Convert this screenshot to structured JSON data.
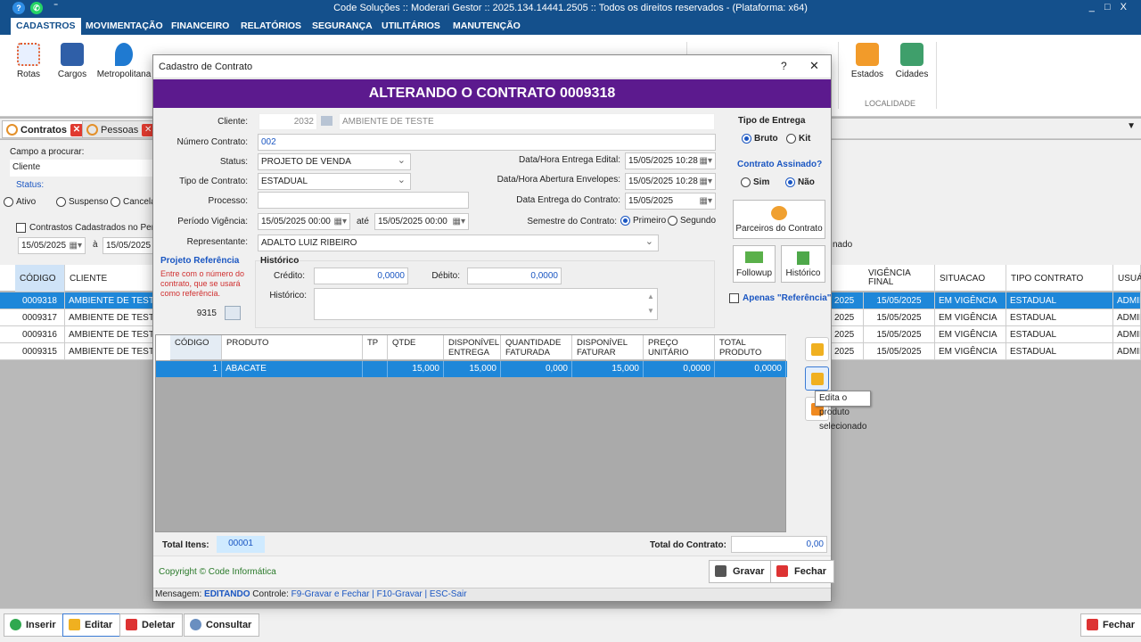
{
  "window": {
    "title": "Code Soluções :: Moderari Gestor :: 2025.134.14441.2505 :: Todos os direitos reservados - (Plataforma: x64)",
    "controls": "_ □ X"
  },
  "menu": [
    "CADASTROS",
    "MOVIMENTAÇÃO",
    "FINANCEIRO",
    "RELATÓRIOS",
    "SEGURANÇA",
    "UTILITÁRIOS",
    "MANUTENÇÃO"
  ],
  "ribbon": {
    "items": [
      "Rotas",
      "Cargos",
      "Metropolitana"
    ],
    "right_items": [
      "Estados",
      "Cidades"
    ],
    "group_label": "LOCALIDADE",
    "extra": "nado"
  },
  "tabs": [
    "Contratos",
    "Pessoas"
  ],
  "filter": {
    "campo_label": "Campo a procurar:",
    "campo_value": "Cliente",
    "status_label": "Status:",
    "status_opts": [
      "Ativo",
      "Suspenso",
      "Cancela"
    ],
    "periodo_label": "Contrastos Cadastrados no Período",
    "date_from": "15/05/2025",
    "a": "à",
    "date_to": "15/05/2025"
  },
  "grid": {
    "headers": [
      "CÓDIGO",
      "CLIENTE",
      "VIGÊNCIA FINAL",
      "SITUACAO",
      "TIPO CONTRATO",
      "USUÁ"
    ],
    "rows": [
      {
        "codigo": "0009318",
        "cliente": "AMBIENTE DE TESTE",
        "frag": "2025",
        "vig": "15/05/2025",
        "sit": "EM VIGÊNCIA",
        "tipo": "ESTADUAL",
        "usr": "ADMIN"
      },
      {
        "codigo": "0009317",
        "cliente": "AMBIENTE DE TESTE",
        "frag": "2025",
        "vig": "15/05/2025",
        "sit": "EM VIGÊNCIA",
        "tipo": "ESTADUAL",
        "usr": "ADMIN"
      },
      {
        "codigo": "0009316",
        "cliente": "AMBIENTE DE TESTE",
        "frag": "2025",
        "vig": "15/05/2025",
        "sit": "EM VIGÊNCIA",
        "tipo": "ESTADUAL",
        "usr": "ADMIN"
      },
      {
        "codigo": "0009315",
        "cliente": "AMBIENTE DE TESTE",
        "frag": "2025",
        "vig": "15/05/2025",
        "sit": "EM VIGÊNCIA",
        "tipo": "ESTADUAL",
        "usr": "ADMIN"
      }
    ]
  },
  "bottom": {
    "inserir": "Inserir",
    "editar": "Editar",
    "deletar": "Deletar",
    "consultar": "Consultar",
    "fechar": "Fechar"
  },
  "dialog": {
    "title": "Cadastro de Contrato",
    "help": "?",
    "close": "✕",
    "banner": "ALTERANDO O CONTRATO 0009318",
    "cliente_label": "Cliente:",
    "cliente_code": "2032",
    "cliente_name": "AMBIENTE DE TESTE",
    "numero_label": "Número Contrato:",
    "numero_value": "002",
    "status_label": "Status:",
    "status_value": "PROJETO DE VENDA",
    "tipo_label": "Tipo de Contrato:",
    "tipo_value": "ESTADUAL",
    "processo_label": "Processo:",
    "processo_value": "",
    "vigencia_label": "Período Vigência:",
    "vig_from": "15/05/2025 00:00",
    "ate": "até",
    "vig_to": "15/05/2025 00:00",
    "rep_label": "Representante:",
    "rep_value": "ADALTO LUIZ RIBEIRO",
    "entrega_edital_label": "Data/Hora Entrega Edital:",
    "entrega_edital": "15/05/2025 10:28",
    "abertura_label": "Data/Hora Abertura Envelopes:",
    "abertura": "15/05/2025 10:28",
    "entrega_contrato_label": "Data Entrega do Contrato:",
    "entrega_contrato": "15/05/2025",
    "semestre_label": "Semestre do Contrato:",
    "semestre_opts": [
      "Primeiro",
      "Segundo"
    ],
    "tipo_entrega_label": "Tipo de Entrega",
    "tipo_entrega_opts": [
      "Bruto",
      "Kit"
    ],
    "assinado_label": "Contrato Assinado?",
    "assinado_opts": [
      "Sim",
      "Não"
    ],
    "parceiros": "Parceiros do Contrato",
    "followup": "Followup",
    "historico_btn": "Histórico",
    "apenas_ref": "Apenas \"Referência\"",
    "proj_ref_title": "Projeto Referência",
    "proj_ref_text": "Entre com o número do contrato, que se usará como referência.",
    "proj_ref_value": "9315",
    "hist_title": "Histórico",
    "credito_label": "Crédito:",
    "credito": "0,0000",
    "debito_label": "Débito:",
    "debito": "0,0000",
    "historico_label": "Histórico:",
    "prod_headers": [
      "CÓDIGO",
      "PRODUTO",
      "TP",
      "QTDE",
      "DISPONÍVEL ENTREGA",
      "QUANTIDADE FATURADA",
      "DISPONÍVEL FATURAR",
      "PREÇO UNITÁRIO",
      "TOTAL PRODUTO"
    ],
    "prod_row": [
      "1",
      "ABACATE",
      "",
      "15,000",
      "15,000",
      "0,000",
      "15,000",
      "0,0000",
      "0,0000"
    ],
    "tooltip": "Edita o produto selecionado",
    "total_itens_label": "Total Itens:",
    "total_itens": "00001",
    "total_contrato_label": "Total do Contrato:",
    "total_contrato": "0,00",
    "copyright": "Copyright © Code Informática",
    "gravar": "Gravar",
    "fechar": "Fechar",
    "msg_label": "Mensagem:",
    "msg_value": "EDITANDO",
    "ctrl_label": "Controle:",
    "ctrl_value": "F9-Gravar e Fechar | F10-Gravar | ESC-Sair"
  }
}
